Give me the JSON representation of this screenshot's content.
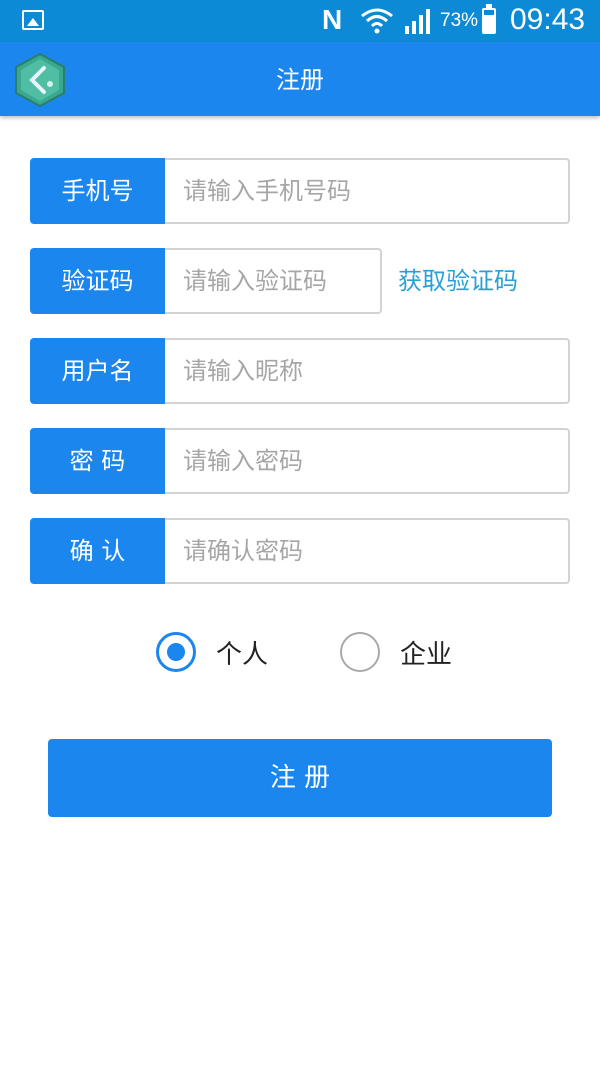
{
  "status_bar": {
    "n_label": "N",
    "battery_pct": "73%",
    "time": "09:43"
  },
  "header": {
    "title": "注册",
    "badge_icon": "back-arrow-badge-icon"
  },
  "form": {
    "phone": {
      "label": "手机号",
      "placeholder": "请输入手机号码"
    },
    "code": {
      "label": "验证码",
      "placeholder": "请输入验证码",
      "get_code_label": "获取验证码"
    },
    "username": {
      "label": "用户名",
      "placeholder": "请输入昵称"
    },
    "password": {
      "label": "密 码",
      "placeholder": "请输入密码"
    },
    "confirm": {
      "label": "确 认",
      "placeholder": "请确认密码"
    }
  },
  "account_type": {
    "options": [
      "个人",
      "企业"
    ],
    "selected": "个人"
  },
  "submit_label": "注 册",
  "colors": {
    "primary": "#1a86ee",
    "status_bar": "#0d8ad6",
    "link": "#2a9fd6",
    "placeholder": "#a6a6a6"
  }
}
